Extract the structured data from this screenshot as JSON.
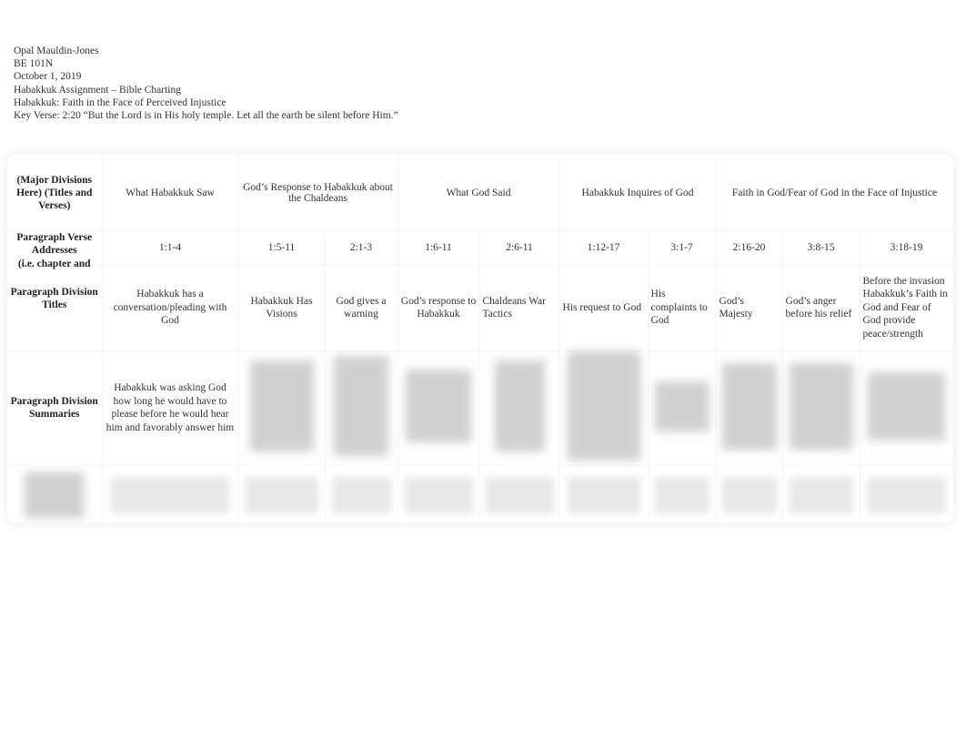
{
  "header": {
    "author": "Opal Mauldin-Jones",
    "course": "BE 101N",
    "date": "October 1, 2019",
    "assignment": "Habakkuk Assignment – Bible Charting",
    "theme": "Habakkuk: Faith in the Face of Perceived Injustice",
    "key_verse": "Key Verse: 2:20 “But the Lord is in His holy temple.  Let all the earth be silent before Him.”"
  },
  "chart": {
    "row_labels": {
      "major_divisions": "(Major Divisions Here) (Titles and Verses)",
      "verse_addresses": "Paragraph Verse Addresses",
      "verse_addresses_note": "(i.e. chapter and",
      "division_titles": "Paragraph Division Titles",
      "summaries": "Paragraph Division Summaries"
    },
    "major_divisions": [
      {
        "title": "What Habakkuk Saw",
        "span": 1
      },
      {
        "title": "God’s Response to Habakkuk about the Chaldeans",
        "span": 2
      },
      {
        "title": "What God Said",
        "span": 2
      },
      {
        "title": "Habakkuk Inquires of God",
        "span": 2
      },
      {
        "title": "Faith in God/Fear of God in the Face of Injustice",
        "span": 3
      }
    ],
    "paragraphs": [
      {
        "verses": "1:1-4",
        "title": "Habakkuk has a conversation/pleading with God",
        "summary": "Habakkuk was asking God how long he would have to please before he would hear him and favorably answer him"
      },
      {
        "verses": "1:5-11",
        "title": "Habakkuk Has Visions",
        "summary": null
      },
      {
        "verses": "2:1-3",
        "title": "God gives a warning",
        "summary": null
      },
      {
        "verses": "1:6-11",
        "title": "God’s response to Habakkuk",
        "summary": null
      },
      {
        "verses": "2:6-11",
        "title": "Chaldeans War Tactics",
        "summary": null
      },
      {
        "verses": "1:12-17",
        "title": "His request to God",
        "summary": null
      },
      {
        "verses": "3:1-7",
        "title": "His complaints to God",
        "summary": null
      },
      {
        "verses": "2:16-20",
        "title": "God’s Majesty",
        "summary": null
      },
      {
        "verses": "3:8-15",
        "title": "God’s anger before his relief",
        "summary": null
      },
      {
        "verses": "3:18-19",
        "title": "Before the invasion Habakkuk’s Faith in God and Fear of God provide peace/strength",
        "summary": null
      }
    ]
  }
}
